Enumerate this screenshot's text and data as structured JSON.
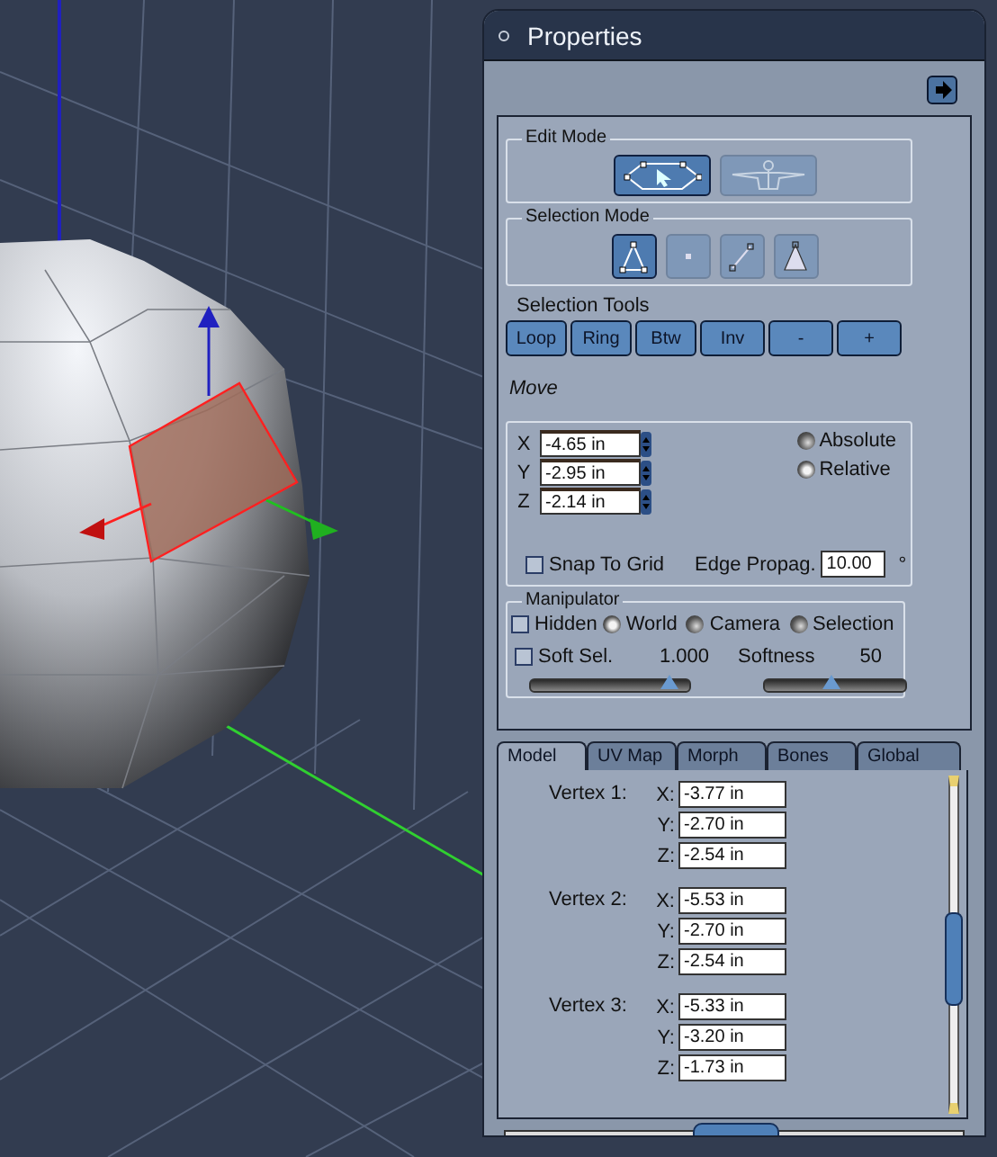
{
  "panel": {
    "title": "Properties"
  },
  "edit_mode": {
    "label": "Edit Mode",
    "buttons": [
      {
        "kind": "polygon",
        "selected": true
      },
      {
        "kind": "figure",
        "selected": false
      }
    ]
  },
  "selection_mode": {
    "label": "Selection Mode",
    "buttons": [
      {
        "kind": "triangle",
        "selected": true
      },
      {
        "kind": "vertex",
        "selected": false
      },
      {
        "kind": "edge",
        "selected": false
      },
      {
        "kind": "face",
        "selected": false
      }
    ]
  },
  "selection_tools": {
    "label": "Selection Tools",
    "buttons": [
      "Loop",
      "Ring",
      "Btw",
      "Inv",
      "-",
      "+"
    ]
  },
  "move": {
    "label": "Move",
    "fields": [
      {
        "axis": "X",
        "value": "-4.65 in"
      },
      {
        "axis": "Y",
        "value": "-2.95 in"
      },
      {
        "axis": "Z",
        "value": "-2.14 in"
      }
    ],
    "modes": [
      {
        "label": "Absolute",
        "selected": false
      },
      {
        "label": "Relative",
        "selected": true
      }
    ],
    "snap_to_grid": {
      "label": "Snap To Grid",
      "checked": false
    },
    "edge_propag": {
      "label": "Edge Propag.",
      "value": "10.00",
      "unit": "°"
    }
  },
  "manipulator": {
    "label": "Manipulator",
    "hidden": {
      "label": "Hidden",
      "checked": false
    },
    "modes": [
      {
        "label": "World",
        "selected": true
      },
      {
        "label": "Camera",
        "selected": false
      },
      {
        "label": "Selection",
        "selected": false
      }
    ],
    "soft_sel": {
      "label": "Soft Sel.",
      "checked": false,
      "reading": "1.000",
      "level": 0.88
    },
    "softness": {
      "label": "Softness",
      "reading": "50",
      "level": 0.48
    }
  },
  "tabs": [
    {
      "label": "Model",
      "selected": true
    },
    {
      "label": "UV Map",
      "selected": false
    },
    {
      "label": "Morph",
      "selected": false
    },
    {
      "label": "Bones",
      "selected": false
    },
    {
      "label": "Global",
      "selected": false
    }
  ],
  "vertices": [
    {
      "label": "Vertex 1:",
      "coords": [
        {
          "axis": "X:",
          "value": "-3.77 in"
        },
        {
          "axis": "Y:",
          "value": "-2.70 in"
        },
        {
          "axis": "Z:",
          "value": "-2.54 in"
        }
      ]
    },
    {
      "label": "Vertex 2:",
      "coords": [
        {
          "axis": "X:",
          "value": "-5.53 in"
        },
        {
          "axis": "Y:",
          "value": "-2.70 in"
        },
        {
          "axis": "Z:",
          "value": "-2.54 in"
        }
      ]
    },
    {
      "label": "Vertex 3:",
      "coords": [
        {
          "axis": "X:",
          "value": "-5.33 in"
        },
        {
          "axis": "Y:",
          "value": "-3.20 in"
        },
        {
          "axis": "Z:",
          "value": "-1.73 in"
        }
      ]
    }
  ]
}
